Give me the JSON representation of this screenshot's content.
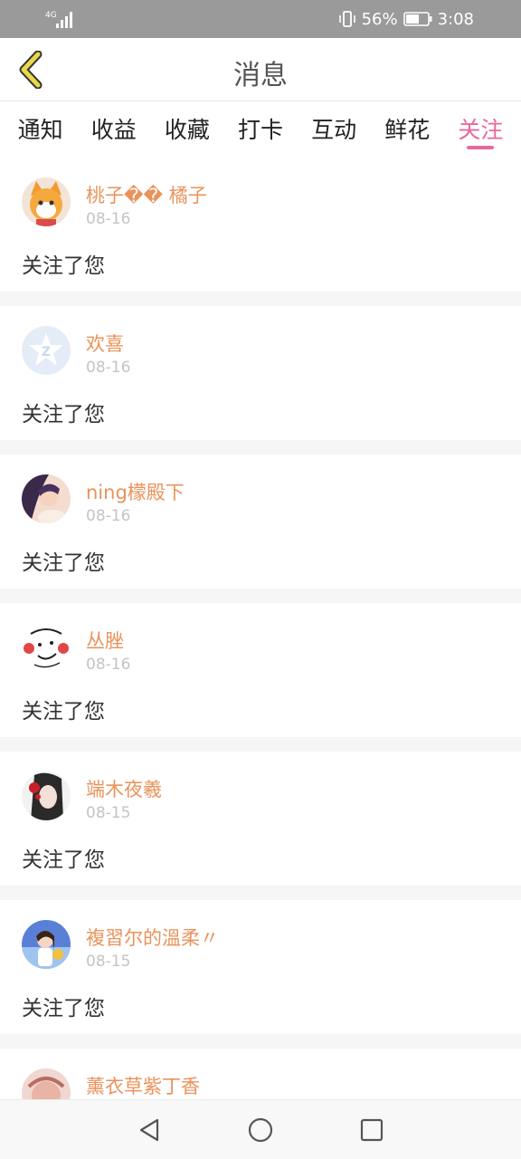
{
  "status_bar": {
    "network": "4G",
    "battery": "56%",
    "time": "3:08",
    "icons": [
      "signal-icon",
      "vibrate-icon",
      "battery-icon"
    ]
  },
  "header": {
    "title": "消息",
    "back_icon": "chevron-left-icon",
    "accent_color": "#e8d84a"
  },
  "tabs": [
    {
      "label": "通知"
    },
    {
      "label": "收益"
    },
    {
      "label": "收藏"
    },
    {
      "label": "打卡"
    },
    {
      "label": "互动"
    },
    {
      "label": "鲜花"
    },
    {
      "label": "关注",
      "active": true
    }
  ],
  "tab_active_color": "#e8699b",
  "followers": [
    {
      "name": "桃子�� 橘子",
      "date": "08-16",
      "action": "关注了您"
    },
    {
      "name": "欢喜",
      "date": "08-16",
      "action": "关注了您"
    },
    {
      "name": "ning檬殿下",
      "date": "08-16",
      "action": "关注了您"
    },
    {
      "name": "丛脞",
      "date": "08-16",
      "action": "关注了您"
    },
    {
      "name": "端木夜羲",
      "date": "08-15",
      "action": "关注了您"
    },
    {
      "name": "複習尔的溫柔〃",
      "date": "08-15",
      "action": "关注了您"
    },
    {
      "name": "薰衣草紫丁香",
      "date": "",
      "action": ""
    }
  ],
  "name_color": "#e9935b",
  "nav_bar": {
    "icons": [
      "back-triangle-icon",
      "home-circle-icon",
      "recents-square-icon"
    ]
  }
}
